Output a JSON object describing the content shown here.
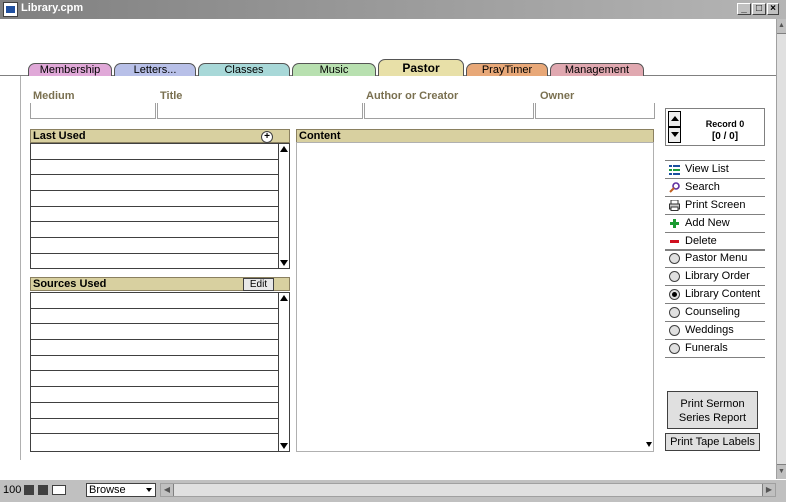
{
  "window": {
    "title": "Library.cpm"
  },
  "tabs": [
    {
      "label": "Membership",
      "color": "#e0a8d8"
    },
    {
      "label": "Letters...",
      "color": "#b8c0e8"
    },
    {
      "label": "Classes",
      "color": "#a8d8d8"
    },
    {
      "label": "Music",
      "color": "#b8e0b0"
    },
    {
      "label": "Pastor",
      "color": "#e8e0a8",
      "active": true
    },
    {
      "label": "PrayTimer",
      "color": "#e8a878"
    },
    {
      "label": "Management",
      "color": "#e0a8b0"
    }
  ],
  "fields": {
    "medium": "Medium",
    "title": "Title",
    "author": "Author or Creator",
    "owner": "Owner"
  },
  "record": {
    "label": "Record 0",
    "count": "[0 / 0]"
  },
  "last_used": {
    "header": "Last Used",
    "plus": "+"
  },
  "sources_used": {
    "header": "Sources Used",
    "edit": "Edit"
  },
  "content": {
    "header": "Content"
  },
  "actions": [
    {
      "label": "View List",
      "icon": "list-icon"
    },
    {
      "label": "Search",
      "icon": "search-icon"
    },
    {
      "label": "Print Screen",
      "icon": "printer-icon"
    },
    {
      "label": "Add New",
      "icon": "plus-icon"
    },
    {
      "label": "Delete",
      "icon": "minus-icon"
    }
  ],
  "radios": [
    {
      "label": "Pastor Menu",
      "selected": false
    },
    {
      "label": "Library Order",
      "selected": false
    },
    {
      "label": "Library Content",
      "selected": true
    },
    {
      "label": "Counseling",
      "selected": false
    },
    {
      "label": "Weddings",
      "selected": false
    },
    {
      "label": "Funerals",
      "selected": false
    }
  ],
  "buttons": {
    "print_sermon_line1": "Print Sermon",
    "print_sermon_line2": "Series Report",
    "print_tape": "Print Tape Labels"
  },
  "statusbar": {
    "zoom": "100",
    "mode": "Browse"
  },
  "colors": {
    "section_header": "#d8d0a0",
    "label_text": "#7a7050"
  }
}
